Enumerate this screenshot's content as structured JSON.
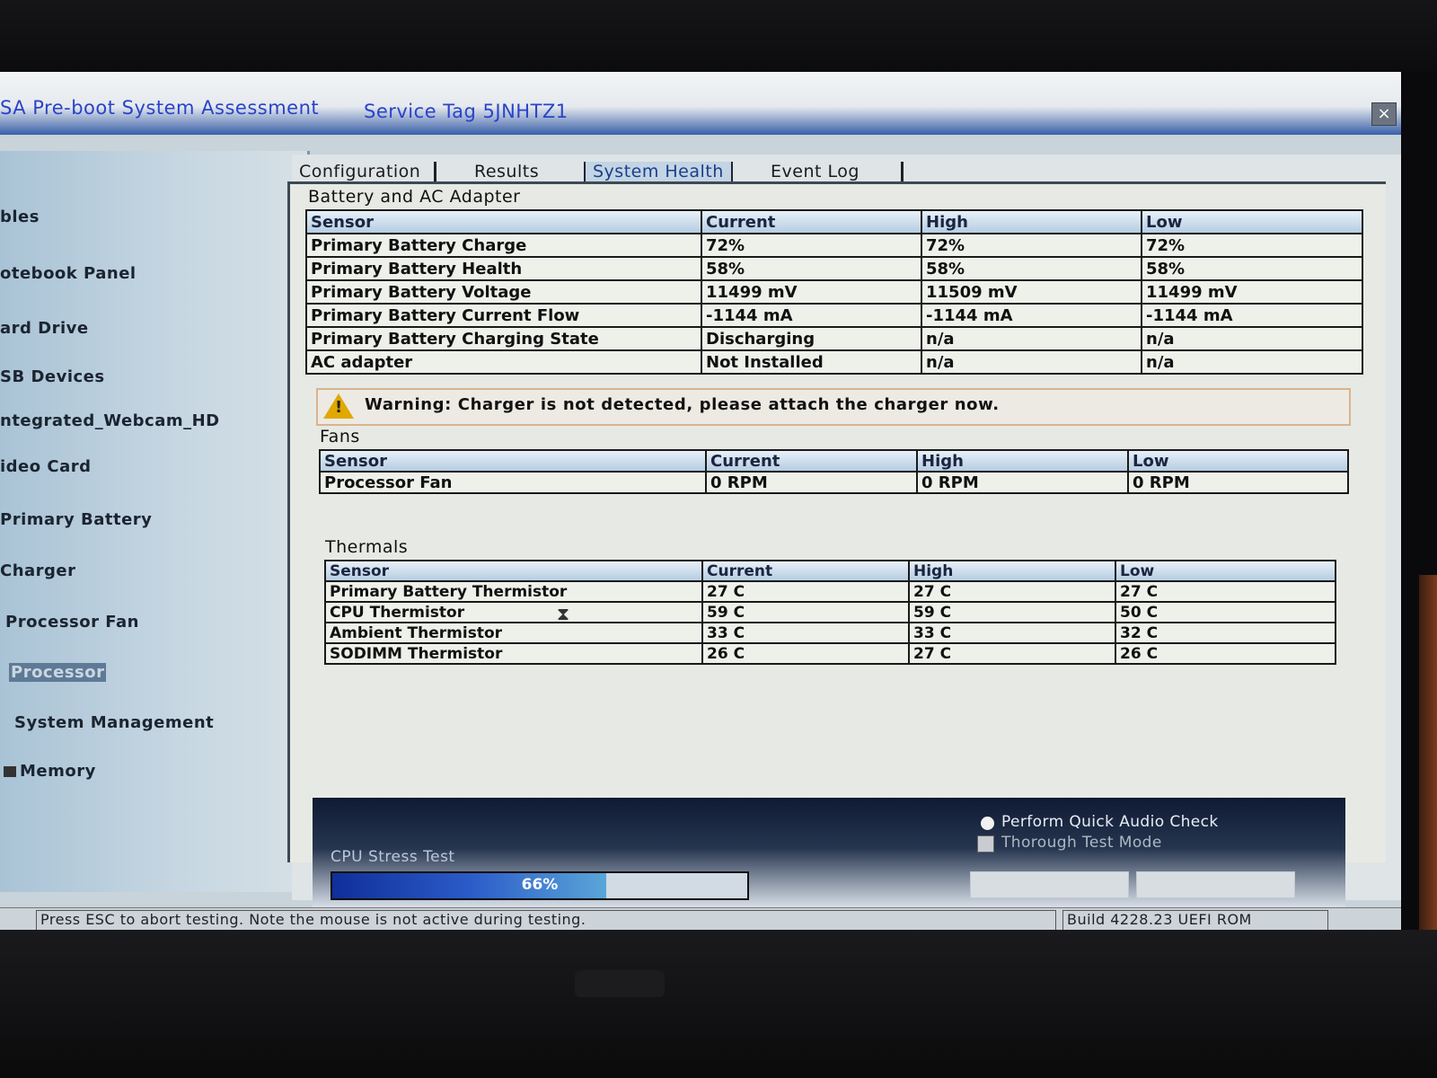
{
  "window": {
    "title": "SA Pre-boot System Assessment",
    "service_tag": "Service Tag 5JNHTZ1",
    "close_label": "×"
  },
  "sidebar": {
    "items": [
      {
        "label": "bles"
      },
      {
        "label": "otebook Panel"
      },
      {
        "label": "ard Drive"
      },
      {
        "label": "SB Devices"
      },
      {
        "label": "ntegrated_Webcam_HD"
      },
      {
        "label": "ideo Card"
      },
      {
        "label": "Primary Battery"
      },
      {
        "label": "Charger"
      },
      {
        "label": "Processor Fan"
      },
      {
        "label": "Processor",
        "selected": true
      },
      {
        "label": "System Management"
      },
      {
        "label": "Memory"
      }
    ]
  },
  "tabs": [
    {
      "label": "Configuration",
      "active": false
    },
    {
      "label": "Results",
      "active": false
    },
    {
      "label": "System Health",
      "active": true
    },
    {
      "label": "Event Log",
      "active": false
    }
  ],
  "battery": {
    "title": "Battery and AC Adapter",
    "headers": [
      "Sensor",
      "Current",
      "High",
      "Low"
    ],
    "rows": [
      [
        "Primary Battery Charge",
        "72%",
        "72%",
        "72%"
      ],
      [
        "Primary Battery Health",
        "58%",
        "58%",
        "58%"
      ],
      [
        "Primary Battery Voltage",
        "11499 mV",
        "11509 mV",
        "11499 mV"
      ],
      [
        "Primary Battery Current Flow",
        "-1144 mA",
        "-1144 mA",
        "-1144 mA"
      ],
      [
        "Primary Battery Charging State",
        "Discharging",
        "n/a",
        "n/a"
      ],
      [
        "AC adapter",
        "Not Installed",
        "n/a",
        "n/a"
      ]
    ]
  },
  "warning": {
    "icon": "warning-triangle-icon",
    "text": "Warning: Charger is not detected, please attach the charger now."
  },
  "fans": {
    "title": "Fans",
    "headers": [
      "Sensor",
      "Current",
      "High",
      "Low"
    ],
    "rows": [
      [
        "Processor Fan",
        "0 RPM",
        "0 RPM",
        "0 RPM"
      ]
    ]
  },
  "thermals": {
    "title": "Thermals",
    "headers": [
      "Sensor",
      "Current",
      "High",
      "Low"
    ],
    "rows": [
      [
        "Primary Battery Thermistor",
        "27 C",
        "27 C",
        "27 C"
      ],
      [
        "CPU Thermistor",
        "59 C",
        "59 C",
        "50 C"
      ],
      [
        "Ambient Thermistor",
        "33 C",
        "33 C",
        "32 C"
      ],
      [
        "SODIMM Thermistor",
        "26 C",
        "27 C",
        "26 C"
      ]
    ]
  },
  "bottom": {
    "audio_check_label": "Perform Quick Audio Check",
    "thorough_label": "Thorough Test Mode",
    "cpu_test_label": "CPU Stress Test",
    "progress_percent": 66,
    "progress_text": "66%"
  },
  "status": {
    "left": "Press ESC to abort testing.  Note the mouse is not active during testing.",
    "right": "Build  4228.23 UEFI ROM"
  }
}
